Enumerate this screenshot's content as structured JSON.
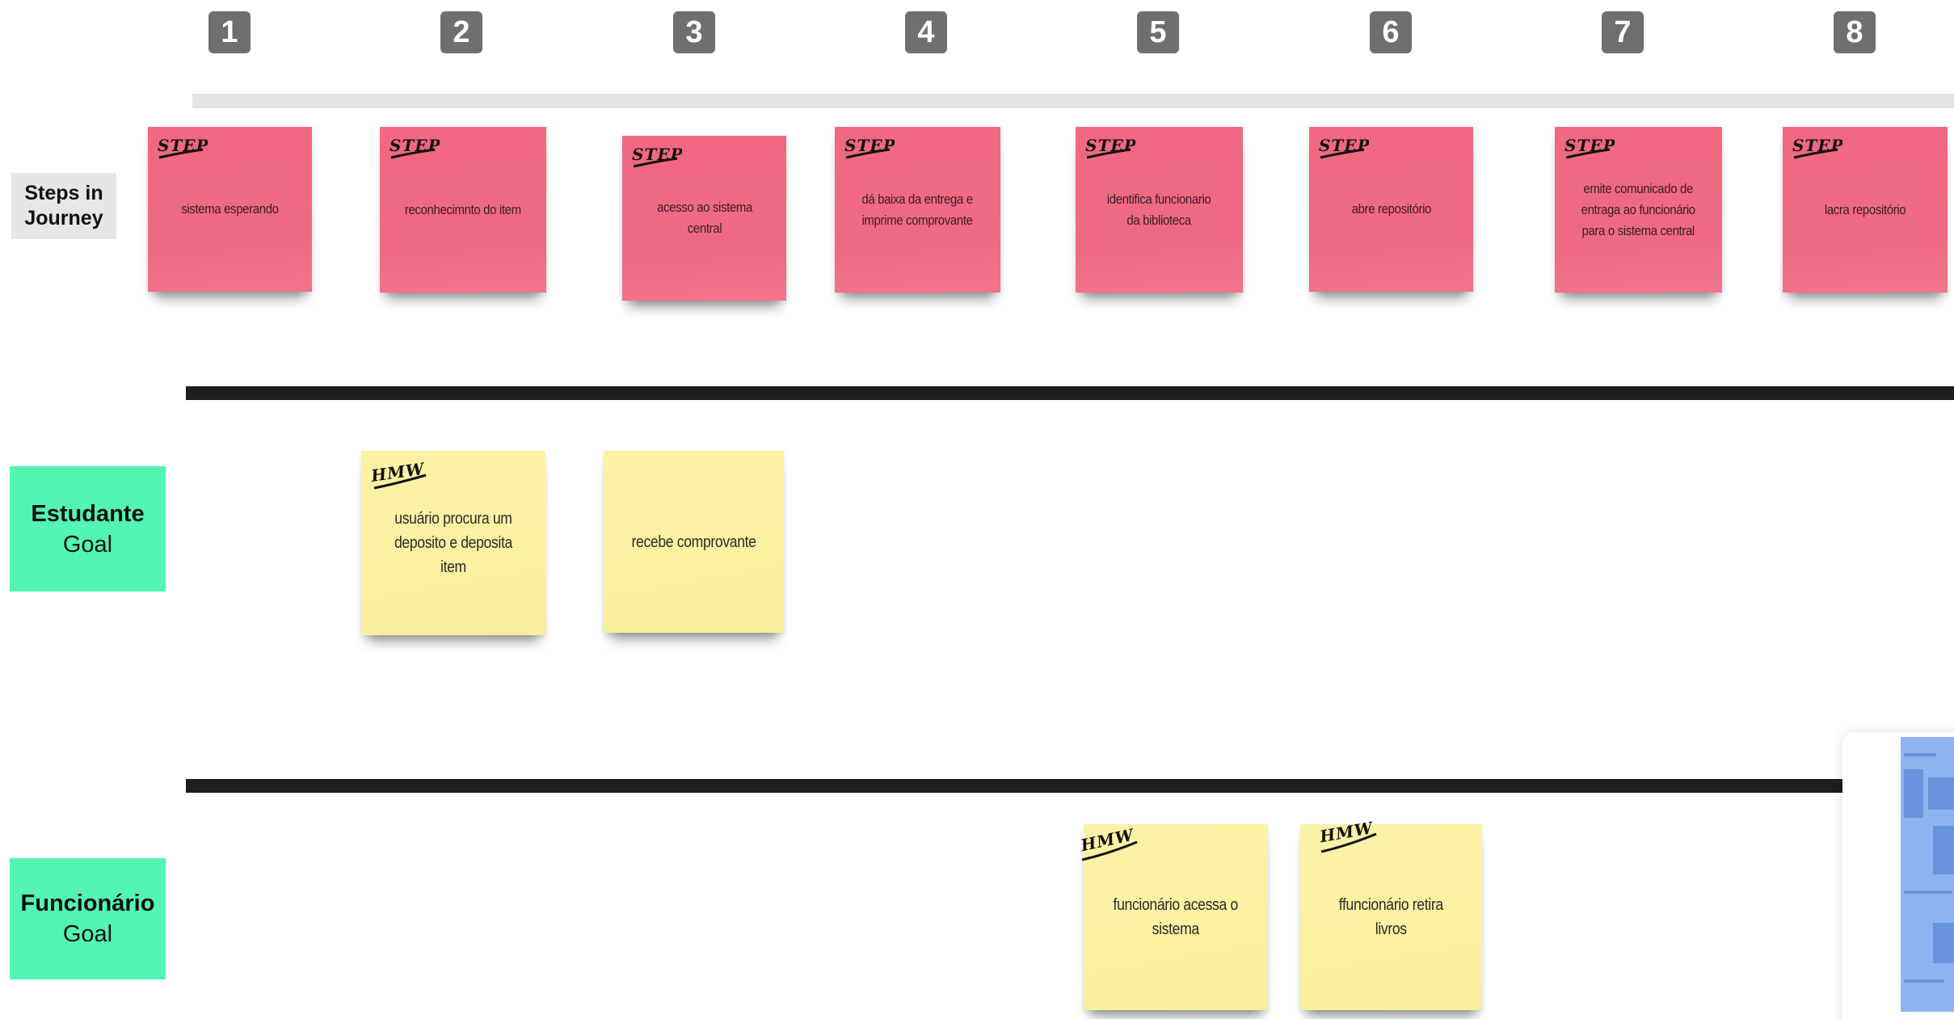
{
  "steps": [
    {
      "num": "1",
      "tag": "STEP",
      "text": "sistema esperando"
    },
    {
      "num": "2",
      "tag": "STEP",
      "text": "reconhecimnto do item"
    },
    {
      "num": "3",
      "tag": "STEP",
      "text": "acesso ao sistema\ncentral"
    },
    {
      "num": "4",
      "tag": "STEP",
      "text": "dá baixa da entrega e\nimprime comprovante"
    },
    {
      "num": "5",
      "tag": "STEP",
      "text": "identifica funcionario\nda biblioteca"
    },
    {
      "num": "6",
      "tag": "STEP",
      "text": "abre repositório"
    },
    {
      "num": "7",
      "tag": "STEP",
      "text": "emite comunicado de\nentraga ao funcionário\npara o sistema central"
    },
    {
      "num": "8",
      "tag": "STEP",
      "text": "lacra repositório"
    }
  ],
  "rows": {
    "steps_label": "Steps in\nJourney",
    "estudante": {
      "name": "Estudante",
      "sub": "Goal"
    },
    "funcionario": {
      "name": "Funcionário",
      "sub": "Goal"
    }
  },
  "estudante_notes": [
    {
      "tag": "HMW",
      "text": "usuário procura um\ndeposito e deposita\nitem"
    },
    {
      "tag": "",
      "text": "recebe comprovante"
    }
  ],
  "funcionario_notes": [
    {
      "tag": "HMW",
      "text": "funcionário acessa o\nsistema"
    },
    {
      "tag": "HMW",
      "text": "ffuncionário retira\nlivros"
    }
  ],
  "colors": {
    "step_note": "#f06b85",
    "hmw_note": "#fbf2a2",
    "goal_label": "#52f5b3",
    "badge": "#6f6f6f"
  }
}
